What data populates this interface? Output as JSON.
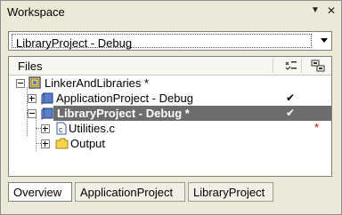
{
  "window": {
    "title": "Workspace"
  },
  "config_select": {
    "value": "LibraryProject - Debug"
  },
  "files_header": {
    "label": "Files"
  },
  "tree": [
    {
      "label": "LinkerAndLibraries *",
      "icon": "workspace-icon",
      "expander": "minus",
      "check": "",
      "flag": ""
    },
    {
      "label": "ApplicationProject - Debug",
      "icon": "project-icon",
      "expander": "plus",
      "check": "✔",
      "flag": ""
    },
    {
      "label": "LibraryProject - Debug *",
      "icon": "project-icon",
      "expander": "minus",
      "check": "✔",
      "flag": "",
      "selected": true
    },
    {
      "label": "Utilities.c",
      "icon": "c-file-icon",
      "expander": "plus",
      "check": "",
      "flag": "*"
    },
    {
      "label": "Output",
      "icon": "folder-icon",
      "expander": "plus",
      "check": "",
      "flag": ""
    }
  ],
  "tabs": [
    {
      "label": "Overview",
      "active": true
    },
    {
      "label": "ApplicationProject",
      "active": false
    },
    {
      "label": "LibraryProject",
      "active": false
    }
  ],
  "colors": {
    "selection": "#6d6d6d",
    "folder": "#f5d64b",
    "project": "#5a7fc8",
    "modified_flag": "#d40000"
  }
}
